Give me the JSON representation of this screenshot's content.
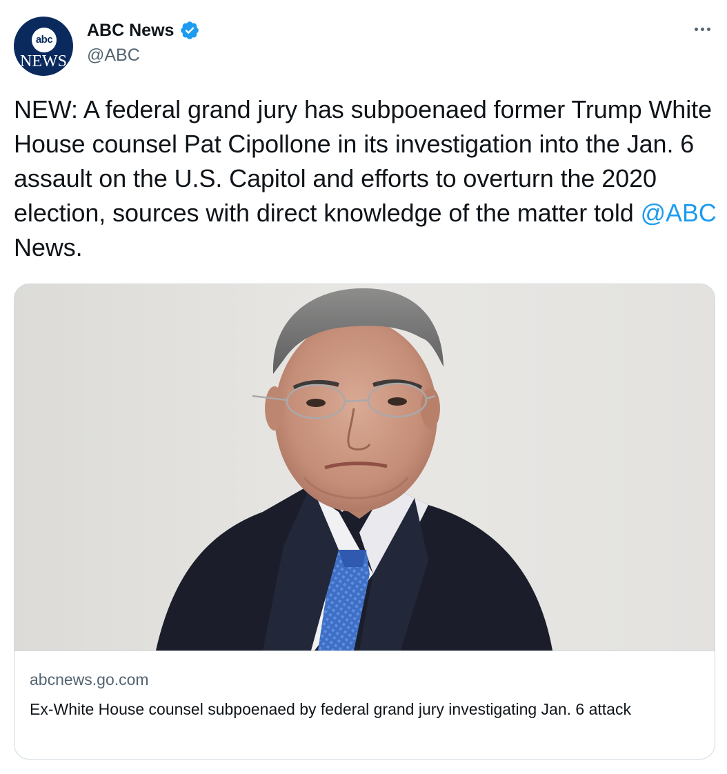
{
  "author": {
    "avatar_top": "abc",
    "avatar_bottom": "NEWS",
    "display_name": "ABC News",
    "handle": "@ABC",
    "verified_icon": "verified-badge-icon",
    "menu_icon": "more-options-icon"
  },
  "tweet": {
    "text_before_mention": "NEW: A federal grand jury has subpoenaed former Trump White House counsel Pat Cipollone in its investigation into the Jan. 6 assault on the U.S. Capitol and efforts to overturn the 2020 election, sources with direct knowledge of the matter told ",
    "mention": "@ABC",
    "text_after_mention": " News."
  },
  "card": {
    "domain": "abcnews.go.com",
    "title": "Ex-White House counsel subpoenaed by federal grand jury investigating Jan. 6 attack"
  },
  "colors": {
    "link": "#1d9bf0",
    "text": "#0f1419",
    "secondary": "#536471",
    "border": "#cfd9de",
    "verified": "#1d9bf0",
    "avatar_bg": "#0a2a5e"
  }
}
